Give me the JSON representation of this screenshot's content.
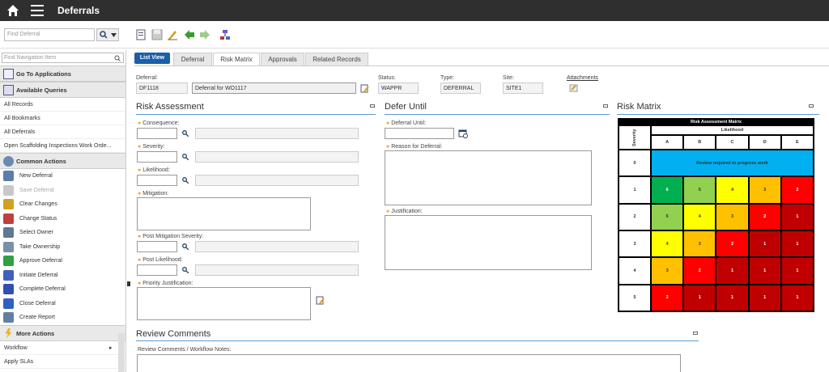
{
  "app": {
    "title": "Deferrals"
  },
  "find": {
    "placeholder": "Find Deferral"
  },
  "nav": {
    "placeholder": "Find Navigation Item",
    "go_to_apps": "Go To Applications",
    "available_queries": "Available Queries",
    "queries": [
      "All Records",
      "All Bookmarks",
      "All Deferrals",
      "Open Scaffolding Inspections Work Orde..."
    ],
    "common_actions": "Common Actions",
    "actions": [
      {
        "label": "New Deferral",
        "color": "#5b7ea8",
        "disabled": false
      },
      {
        "label": "Save Deferral",
        "color": "#c8c8c8",
        "disabled": true
      },
      {
        "label": "Clear Changes",
        "color": "#d4a020",
        "disabled": false
      },
      {
        "label": "Change Status",
        "color": "#c04040",
        "disabled": false
      },
      {
        "label": "Select Owner",
        "color": "#607890",
        "disabled": false
      },
      {
        "label": "Take Ownership",
        "color": "#7890a8",
        "disabled": false
      },
      {
        "label": "Approve Deferral",
        "color": "#30a040",
        "disabled": false
      },
      {
        "label": "Initiate Deferral",
        "color": "#4060c0",
        "disabled": false
      },
      {
        "label": "Complete Deferral",
        "color": "#3050b0",
        "disabled": false
      },
      {
        "label": "Close Deferral",
        "color": "#3060c0",
        "disabled": false
      },
      {
        "label": "Create Report",
        "color": "#6080a0",
        "disabled": false
      }
    ],
    "more_actions": "More Actions",
    "more": [
      "Workflow",
      "Apply SLAs"
    ]
  },
  "tabs": {
    "list_view": "List View",
    "items": [
      "Deferral",
      "Risk Matrix",
      "Approvals",
      "Related Records"
    ],
    "active": 1
  },
  "header": {
    "deferral_label": "Deferral:",
    "deferral_id": "DF1118",
    "deferral_desc": "Deferral for WO1117",
    "status_label": "Status:",
    "status": "WAPPR",
    "type_label": "Type:",
    "type": "DEFERRAL",
    "site_label": "Site:",
    "site": "SITE1",
    "attachments": "Attachments"
  },
  "risk": {
    "title": "Risk Assessment",
    "consequence": "Consequence:",
    "severity": "Severity:",
    "likelihood": "Likelihood:",
    "mitigation": "Mitigation:",
    "post_severity": "Post Mitigation Severity:",
    "post_likelihood": "Post Likelihood:",
    "priority": "Priority Justification:"
  },
  "defer": {
    "title": "Defer Until",
    "until": "Deferral Until:",
    "reason": "Reason for Deferral:",
    "justification": "Justification:"
  },
  "matrix": {
    "title": "Risk Matrix",
    "heading": "Risk Assessment Matrix",
    "likelihood": "Likelihood",
    "severity": "Severity",
    "cols": [
      "A",
      "B",
      "C",
      "D",
      "E"
    ],
    "rows": [
      "0",
      "1",
      "2",
      "3",
      "4",
      "5"
    ],
    "review_text": "Review required to progress work",
    "review_color": "#00b0f0",
    "cells": [
      [
        "6",
        "5",
        "4",
        "3",
        "2"
      ],
      [
        "5",
        "4",
        "3",
        "2",
        "1"
      ],
      [
        "4",
        "3",
        "2",
        "1",
        "1"
      ],
      [
        "3",
        "2",
        "1",
        "1",
        "1"
      ],
      [
        "2",
        "1",
        "1",
        "1",
        "1"
      ]
    ],
    "colors": [
      [
        "#00b050",
        "#92d050",
        "#ffff00",
        "#ffc000",
        "#ff0000"
      ],
      [
        "#92d050",
        "#ffff00",
        "#ffc000",
        "#ff0000",
        "#c00000"
      ],
      [
        "#ffff00",
        "#ffc000",
        "#ff0000",
        "#c00000",
        "#c00000"
      ],
      [
        "#ffc000",
        "#ff0000",
        "#c00000",
        "#c00000",
        "#c00000"
      ],
      [
        "#ff0000",
        "#c00000",
        "#c00000",
        "#c00000",
        "#c00000"
      ]
    ]
  },
  "review": {
    "title": "Review Comments",
    "notes": "Review Comments / Workflow Notes:"
  }
}
